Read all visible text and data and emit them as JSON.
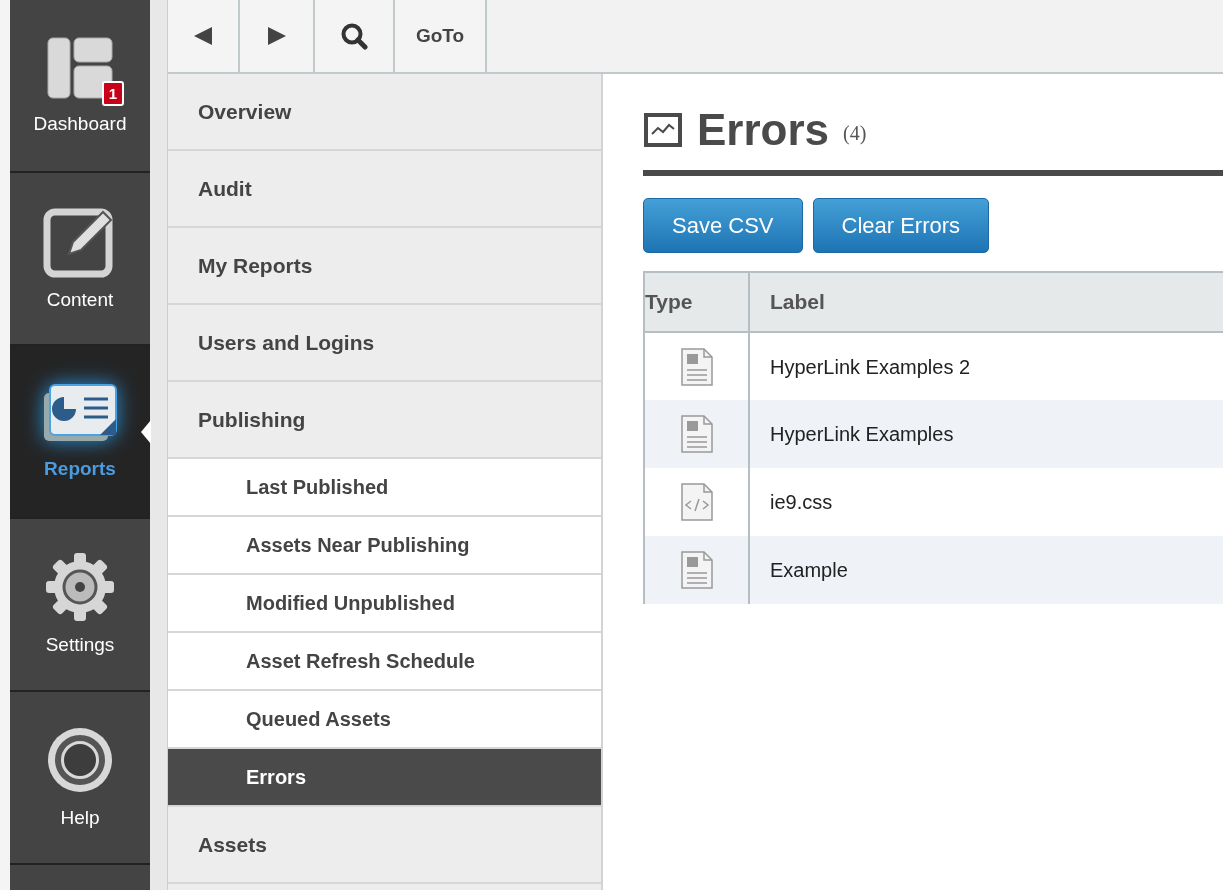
{
  "rail": [
    {
      "label": "Dashboard",
      "kind": "dashboard",
      "badge": "1",
      "selected": false
    },
    {
      "label": "Content",
      "kind": "content",
      "selected": false
    },
    {
      "label": "Reports",
      "kind": "reports",
      "selected": true
    },
    {
      "label": "Settings",
      "kind": "settings",
      "selected": false
    },
    {
      "label": "Help",
      "kind": "help",
      "selected": false
    }
  ],
  "toolbar": [
    {
      "kind": "back"
    },
    {
      "kind": "forward"
    },
    {
      "kind": "search"
    },
    {
      "kind": "text",
      "label": "GoTo"
    }
  ],
  "menu": [
    {
      "label": "Overview",
      "selected": false
    },
    {
      "label": "Audit",
      "selected": false
    },
    {
      "label": "My Reports",
      "selected": false
    },
    {
      "label": "Users and Logins",
      "selected": false
    },
    {
      "label": "Publishing",
      "selected": false,
      "expanded": true,
      "children": [
        {
          "label": "Last Published",
          "selected": false
        },
        {
          "label": "Assets Near Publishing",
          "selected": false
        },
        {
          "label": "Modified Unpublished",
          "selected": false
        },
        {
          "label": "Asset Refresh Schedule",
          "selected": false
        },
        {
          "label": "Queued Assets",
          "selected": false
        },
        {
          "label": "Errors",
          "selected": true
        }
      ]
    },
    {
      "label": "Assets",
      "selected": false
    }
  ],
  "main": {
    "title": "Errors",
    "count": "(4)",
    "buttons": [
      "Save CSV",
      "Clear Errors"
    ],
    "table": {
      "columns": [
        "Type",
        "Label"
      ],
      "rows": [
        {
          "kind": "page",
          "label": "HyperLink Examples 2"
        },
        {
          "kind": "page",
          "label": "HyperLink Examples"
        },
        {
          "kind": "code",
          "label": "ie9.css"
        },
        {
          "kind": "page",
          "label": "Example"
        }
      ]
    }
  }
}
